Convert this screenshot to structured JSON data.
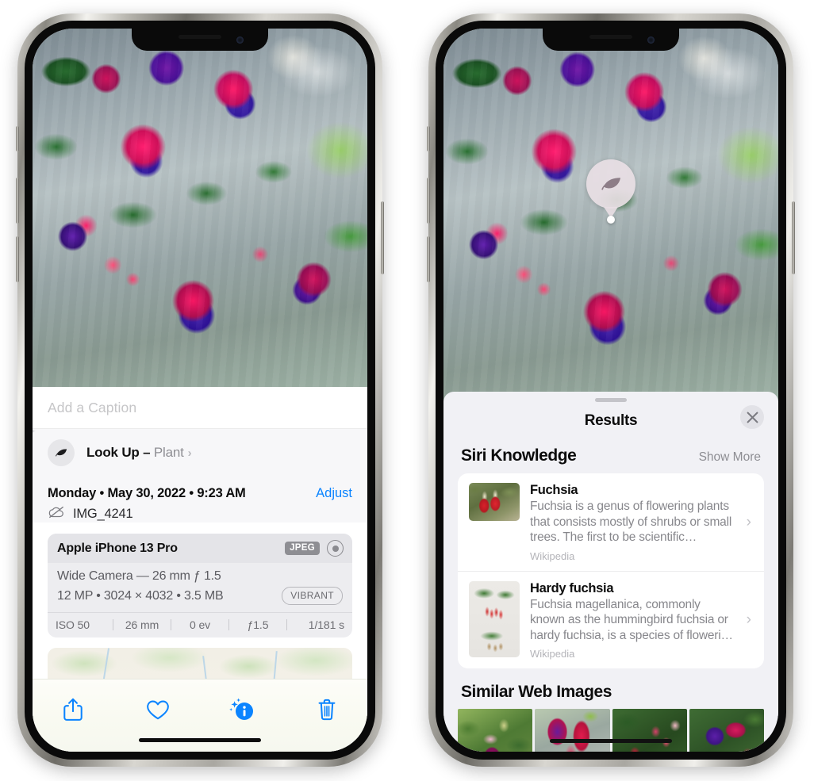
{
  "left_phone": {
    "caption": {
      "placeholder": "Add a Caption",
      "value": ""
    },
    "lookup": {
      "label": "Look Up",
      "dash": " – ",
      "subject": "Plant",
      "chevron": "›",
      "icon": "leaf-icon"
    },
    "metadata": {
      "date_line": "Monday • May 30, 2022 • 9:23 AM",
      "adjust_label": "Adjust",
      "filename": "IMG_4241",
      "cloud_icon": "icloud-slash-icon"
    },
    "camera_card": {
      "model": "Apple iPhone 13 Pro",
      "format_tag": "JPEG",
      "raw_icon": "raw-aperture-icon",
      "lens": "Wide Camera — 26 mm ƒ 1.5",
      "size_line": "12 MP • 3024 × 4032 • 3.5 MB",
      "style_tag": "VIBRANT",
      "exif": [
        "ISO 50",
        "26 mm",
        "0 ev",
        "ƒ1.5",
        "1/181 s"
      ]
    },
    "toolbar": [
      {
        "name": "share-button",
        "icon": "share-icon"
      },
      {
        "name": "favorite-button",
        "icon": "heart-icon"
      },
      {
        "name": "info-button",
        "icon": "info-sparkle-icon"
      },
      {
        "name": "delete-button",
        "icon": "trash-icon"
      }
    ],
    "accent_color": "#0b84ff"
  },
  "right_phone": {
    "lookup_badge": {
      "icon": "leaf-icon"
    },
    "sheet": {
      "title": "Results",
      "close_icon": "close-icon",
      "grabber": "drag-handle"
    },
    "siri_knowledge": {
      "title": "Siri Knowledge",
      "show_more": "Show More",
      "cards": [
        {
          "title": "Fuchsia",
          "description": "Fuchsia is a genus of flowering plants that consists mostly of shrubs or small trees. The first to be scientific…",
          "source": "Wikipedia",
          "chevron": "›"
        },
        {
          "title": "Hardy fuchsia",
          "description": "Fuchsia magellanica, commonly known as the hummingbird fuchsia or hardy fuchsia, is a species of floweri…",
          "source": "Wikipedia",
          "chevron": "›"
        }
      ]
    },
    "similar_web_images": {
      "title": "Similar Web Images",
      "count": 4
    }
  }
}
